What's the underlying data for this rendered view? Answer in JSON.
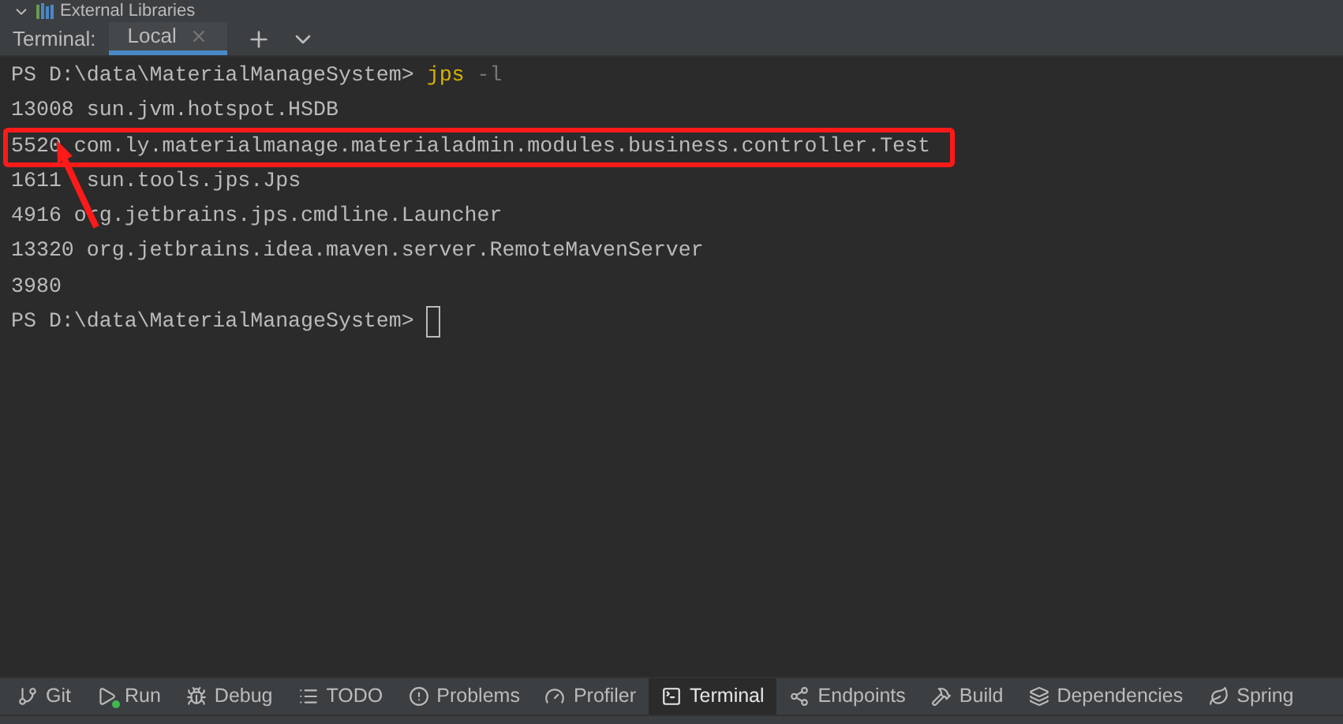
{
  "project_tree": {
    "expanded": true,
    "label": "External Libraries"
  },
  "terminal_tabs": {
    "label": "Terminal:",
    "tabs": [
      {
        "label": "Local",
        "selected": true
      }
    ]
  },
  "terminal": {
    "lines": [
      {
        "kind": "prompt",
        "prompt": "PS D:\\data\\MaterialManageSystem>",
        "command": "jps",
        "args": "-l"
      },
      {
        "kind": "output",
        "text": "13008 sun.jvm.hotspot.HSDB"
      },
      {
        "kind": "output",
        "text": "5520 com.ly.materialmanage.materialadmin.modules.business.controller.Test",
        "highlighted": true
      },
      {
        "kind": "output",
        "text": "1611",
        "tail": "sun.tools.jps.Jps"
      },
      {
        "kind": "output",
        "text": "4916 org.jetbrains.jps.cmdline.Launcher"
      },
      {
        "kind": "output",
        "text": "13320 org.jetbrains.idea.maven.server.RemoteMavenServer"
      },
      {
        "kind": "output",
        "text": "3980"
      },
      {
        "kind": "prompt",
        "prompt": "PS D:\\data\\MaterialManageSystem>",
        "cursor": true
      }
    ]
  },
  "tool_windows": [
    {
      "kind": "git",
      "label": "Git",
      "selected": false
    },
    {
      "kind": "run",
      "label": "Run",
      "selected": false
    },
    {
      "kind": "debug",
      "label": "Debug",
      "selected": false
    },
    {
      "kind": "todo",
      "label": "TODO",
      "selected": false
    },
    {
      "kind": "problems",
      "label": "Problems",
      "selected": false
    },
    {
      "kind": "profiler",
      "label": "Profiler",
      "selected": false
    },
    {
      "kind": "terminal",
      "label": "Terminal",
      "selected": true
    },
    {
      "kind": "endpoints",
      "label": "Endpoints",
      "selected": false
    },
    {
      "kind": "build",
      "label": "Build",
      "selected": false
    },
    {
      "kind": "dependencies",
      "label": "Dependencies",
      "selected": false
    },
    {
      "kind": "spring",
      "label": "Spring",
      "selected": false
    }
  ]
}
